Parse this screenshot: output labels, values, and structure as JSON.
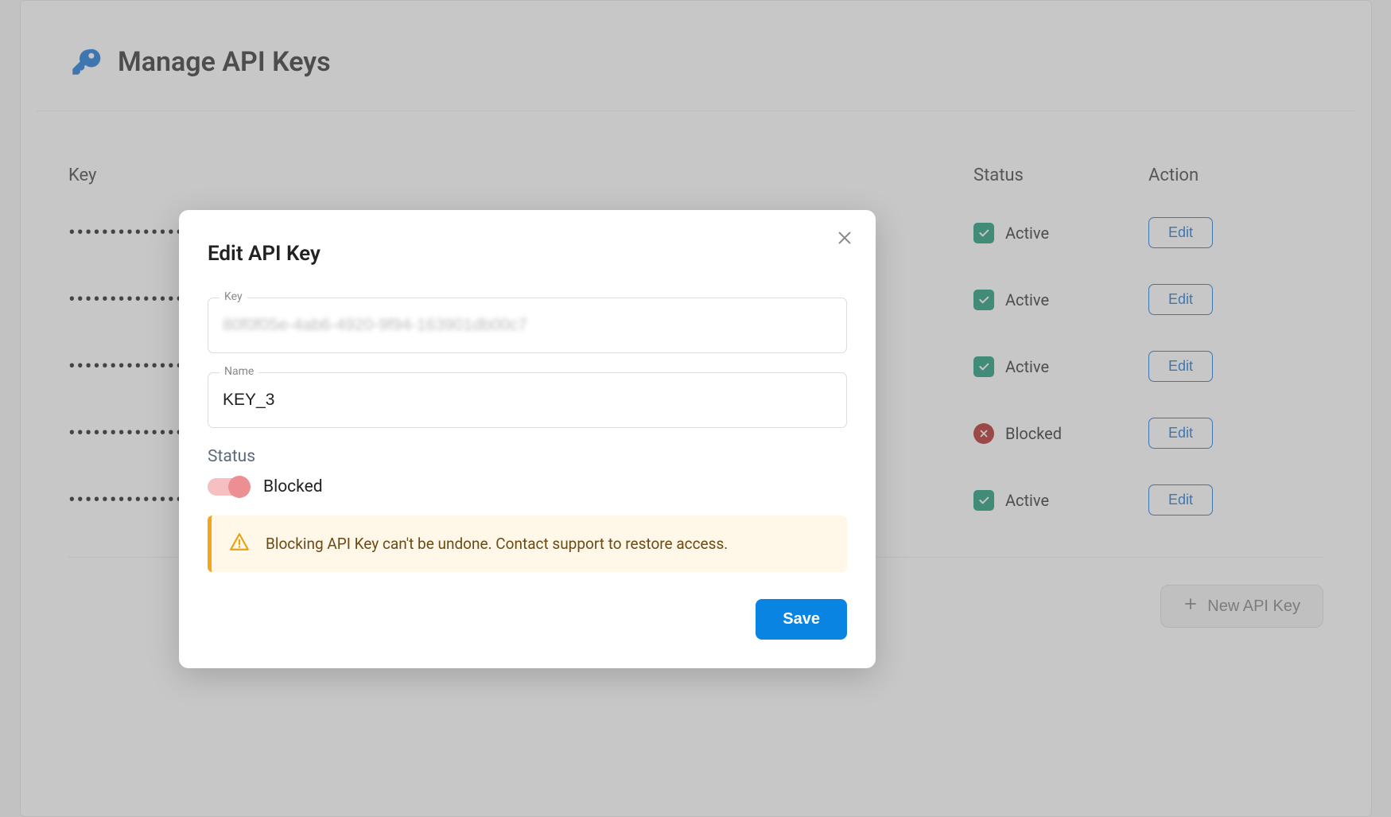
{
  "header": {
    "title": "Manage API Keys"
  },
  "columns": {
    "key": "Key",
    "status": "Status",
    "action": "Action"
  },
  "rows": [
    {
      "key_mask": "••••••••••••••••••••••••••••••••••••",
      "status": "Active",
      "status_kind": "active",
      "action": "Edit"
    },
    {
      "key_mask": "••••••••••••••••••••••••••••••••••••",
      "status": "Active",
      "status_kind": "active",
      "action": "Edit"
    },
    {
      "key_mask": "••••••••••••••••••••••••••••••••••••",
      "status": "Active",
      "status_kind": "active",
      "action": "Edit"
    },
    {
      "key_mask": "••••••••••••••••••••••••••••••••••••",
      "status": "Blocked",
      "status_kind": "blocked",
      "action": "Edit"
    },
    {
      "key_mask": "••••••••••••••••••••••••••••••••••••",
      "status": "Active",
      "status_kind": "active",
      "action": "Edit"
    }
  ],
  "footer": {
    "new_key": "New API Key"
  },
  "modal": {
    "title": "Edit API Key",
    "key_label": "Key",
    "key_value": "80f0f05e-4ab6-4920-9f94-163901db00c7",
    "name_label": "Name",
    "name_value": "KEY_3",
    "status_label": "Status",
    "toggle_value": "Blocked",
    "warning": "Blocking API Key can't be undone. Contact support to restore access.",
    "save": "Save"
  }
}
